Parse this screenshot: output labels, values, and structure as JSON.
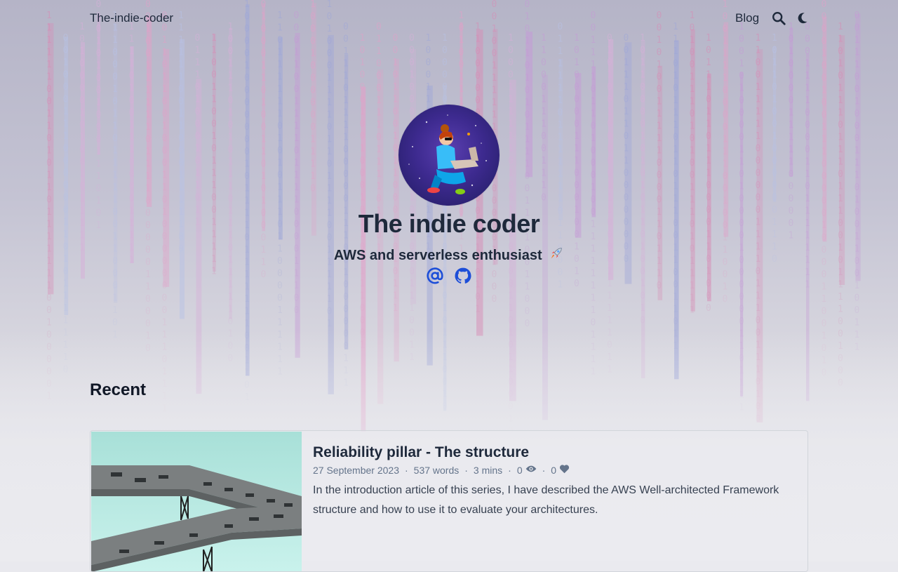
{
  "header": {
    "site_name": "The-indie-coder",
    "nav_blog": "Blog",
    "search_icon": "search-icon",
    "theme_icon": "moon-icon"
  },
  "hero": {
    "title": "The indie coder",
    "subtitle": "AWS and serverless enthusiast",
    "subtitle_emoji": "rocket-icon",
    "social": [
      "at-sign-icon",
      "github-icon"
    ]
  },
  "recent": {
    "heading": "Recent",
    "posts": [
      {
        "title": "Reliability pillar - The structure",
        "date": "27 September 2023",
        "words": "537 words",
        "read_time": "3 mins",
        "views": "0",
        "likes": "0",
        "description": "In the introduction article of this series, I have described the AWS Well-architected Framework structure and how to use it to evaluate your architectures."
      }
    ]
  },
  "colors": {
    "accent": "#1d4ed8",
    "text": "#1e293b",
    "meta": "#64748b"
  }
}
